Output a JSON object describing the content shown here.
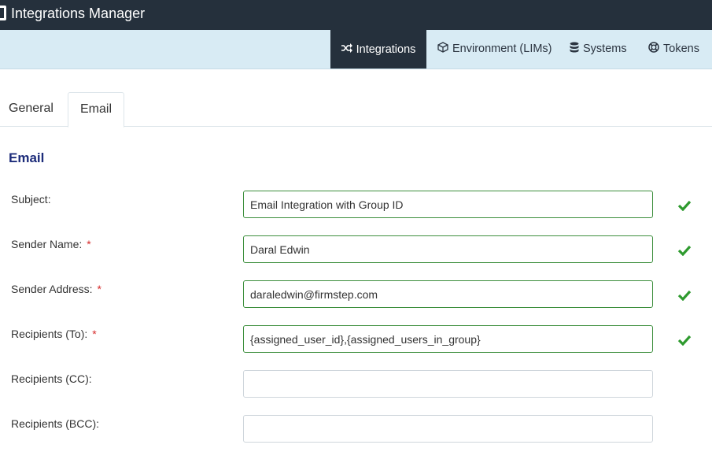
{
  "app": {
    "title": "Integrations Manager"
  },
  "nav": {
    "items": [
      {
        "label": "Integrations",
        "icon": "shuffle-icon"
      },
      {
        "label": "Environment (LIMs)",
        "icon": "cube-icon"
      },
      {
        "label": "Systems",
        "icon": "database-icon"
      },
      {
        "label": "Tokens",
        "icon": "life-ring-icon"
      }
    ],
    "active": "Integrations"
  },
  "tabs": {
    "general": "General",
    "email": "Email",
    "active": "Email"
  },
  "section": {
    "title": "Email"
  },
  "fields": {
    "subject": {
      "label": "Subject:",
      "value": "Email Integration with Group ID",
      "required": false,
      "valid": true
    },
    "sender_name": {
      "label": "Sender Name:",
      "value": "Daral Edwin",
      "required": true,
      "valid": true
    },
    "sender_address": {
      "label": "Sender Address:",
      "value": "daraledwin@firmstep.com",
      "required": true,
      "valid": true
    },
    "recipients_to": {
      "label": "Recipients (To):",
      "value": "{assigned_user_id},{assigned_users_in_group}",
      "required": true,
      "valid": true
    },
    "recipients_cc": {
      "label": "Recipients (CC):",
      "value": "",
      "required": false,
      "valid": false
    },
    "recipients_bcc": {
      "label": "Recipients (BCC):",
      "value": "",
      "required": false,
      "valid": false
    }
  },
  "required_mark": "*",
  "colors": {
    "header_bg": "#25303c",
    "nav_bg": "#d8ebf4",
    "section_title": "#1d2c7a",
    "valid_green": "#2e9a2e",
    "required_red": "#d62b2b"
  }
}
